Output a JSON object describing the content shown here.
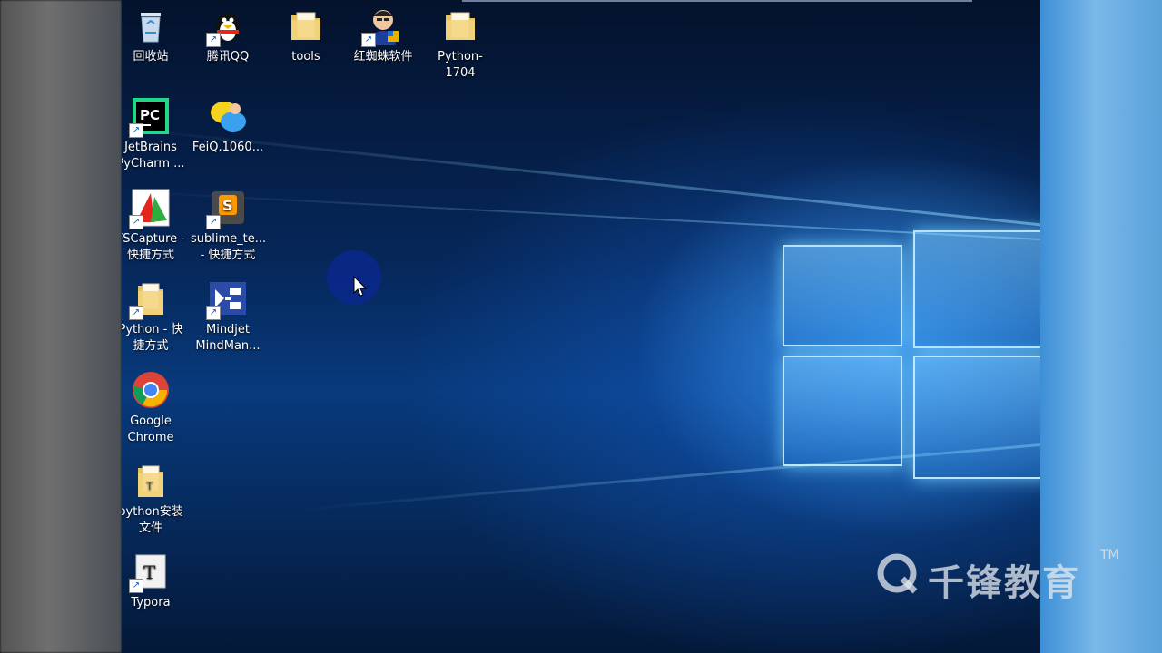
{
  "desktop": {
    "icons": [
      {
        "label": "回收站",
        "icon": "recycle-bin-icon"
      },
      {
        "label": "腾讯QQ",
        "icon": "qq-penguin-icon"
      },
      {
        "label": "tools",
        "icon": "folder-icon"
      },
      {
        "label": "红蜘蛛软件",
        "icon": "red-spider-icon"
      },
      {
        "label": "Python-1704",
        "icon": "folder-icon"
      },
      {
        "label": "JetBrains\nPyCharm ...",
        "icon": "pycharm-icon"
      },
      {
        "label": "FeiQ.1060...",
        "icon": "feiq-chat-icon"
      },
      {
        "label": "FSCapture -\n快捷方式",
        "icon": "fscapture-icon"
      },
      {
        "label": "sublime_te...\n- 快捷方式",
        "icon": "sublime-text-icon"
      },
      {
        "label": "Python - 快\n捷方式",
        "icon": "folder-shortcut-icon"
      },
      {
        "label": "Mindjet\nMindMan...",
        "icon": "mindmanager-icon"
      },
      {
        "label": "Google\nChrome",
        "icon": "chrome-icon"
      },
      {
        "label": "python安装\n文件",
        "icon": "file-folder-icon"
      },
      {
        "label": "Typora",
        "icon": "typora-icon"
      }
    ]
  },
  "watermark": {
    "text": "千锋教育",
    "tm": "TM"
  },
  "colors": {
    "wallpaper_dark": "#04122c",
    "wallpaper_glow": "#46aaff"
  }
}
